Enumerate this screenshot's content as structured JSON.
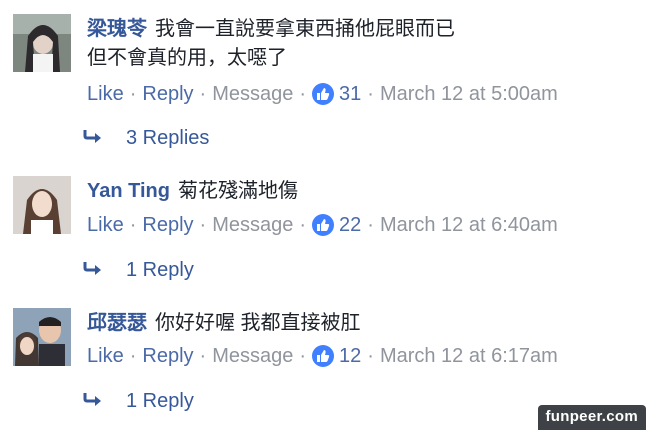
{
  "comments": [
    {
      "author": "梁瑰苓",
      "text_line1": "我會一直說要拿東西捅他屁眼而已",
      "text_line2": "但不會真的用，太噁了",
      "like": "Like",
      "reply": "Reply",
      "message": "Message",
      "like_count": "31",
      "time": "March 12 at 5:00am",
      "replies": "3 Replies"
    },
    {
      "author": "Yan Ting",
      "text_line1": "菊花殘滿地傷",
      "like": "Like",
      "reply": "Reply",
      "message": "Message",
      "like_count": "22",
      "time": "March 12 at 6:40am",
      "replies": "1 Reply"
    },
    {
      "author": "邱瑟瑟",
      "text_line1": "你好好喔 我都直接被肛",
      "like": "Like",
      "reply": "Reply",
      "message": "Message",
      "like_count": "12",
      "time": "March 12 at 6:17am",
      "replies": "1 Reply"
    }
  ],
  "separator": "·",
  "watermark": "funpeer.com",
  "colors": {
    "link": "#365899",
    "meta": "#90949c",
    "like_icon": "#4080ff"
  },
  "icons": [
    "thumbs-up-icon",
    "reply-arrow-icon"
  ]
}
